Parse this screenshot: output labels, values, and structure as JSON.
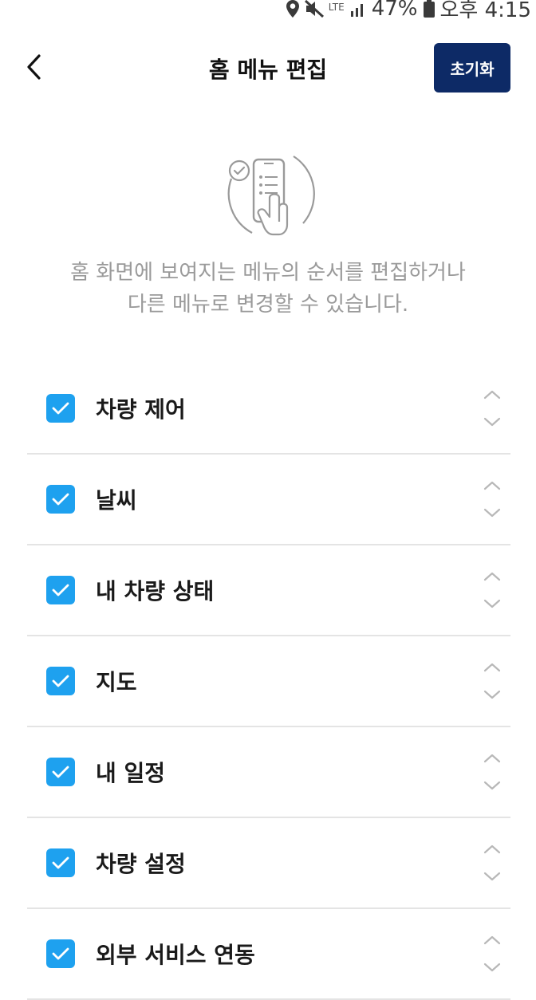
{
  "status_bar": {
    "network": "LTE",
    "battery": "47%",
    "time": "오후 4:15"
  },
  "header": {
    "title": "홈 메뉴 편집",
    "reset_label": "초기화"
  },
  "description": {
    "line1": "홈 화면에 보여지는 메뉴의 순서를 편집하거나",
    "line2": "다른 메뉴로 변경할 수 있습니다."
  },
  "menu": {
    "items": [
      {
        "label": "차량 제어",
        "checked": true
      },
      {
        "label": "날씨",
        "checked": true
      },
      {
        "label": "내 차량 상태",
        "checked": true
      },
      {
        "label": "지도",
        "checked": true
      },
      {
        "label": "내 일정",
        "checked": true
      },
      {
        "label": "차량 설정",
        "checked": true
      },
      {
        "label": "외부 서비스 연동",
        "checked": true
      }
    ]
  },
  "colors": {
    "accent": "#1ea1ef",
    "button": "#0d2a66",
    "muted_text": "#9a9a9a"
  }
}
